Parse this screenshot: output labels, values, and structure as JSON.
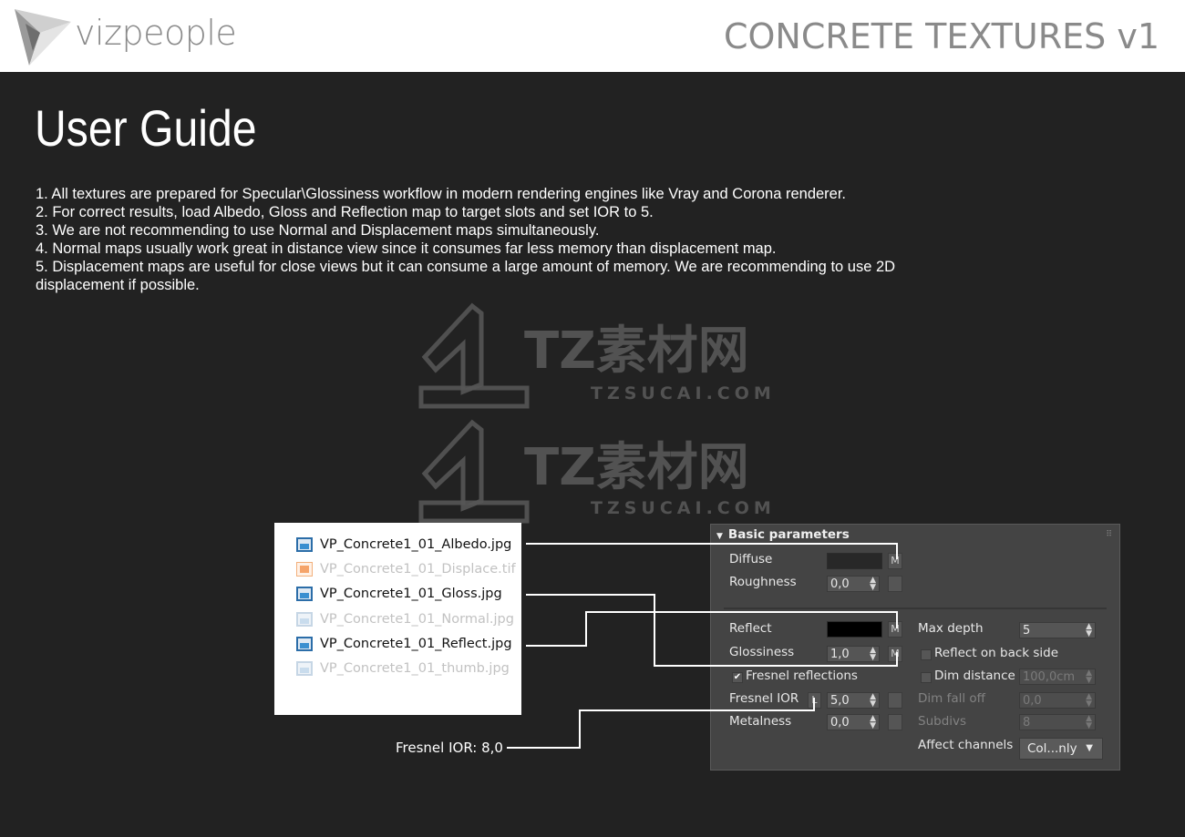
{
  "header": {
    "brand": "vizpeople",
    "product": "CONCRETE TEXTURES v1"
  },
  "title": "User Guide",
  "guide": [
    "1. All textures are prepared for Specular\\Glossiness workflow in modern rendering engines like Vray and Corona renderer.",
    "2. For correct results, load Albedo, Gloss and Reflection map to target slots and set IOR to 5.",
    "3. We are not recommending to use Normal and Displacement maps simultaneously.",
    "4. Normal maps usually work great in distance view since it consumes far less memory than displacement map.",
    "5. Displacement maps are useful for close views but it can consume a large amount of memory. We are recommending to use 2D displacement if possible."
  ],
  "watermark": {
    "text": "TZ素材网",
    "url": "TZSUCAI.COM"
  },
  "files": [
    {
      "name": "VP_Concrete1_01_Albedo.jpg",
      "icon": "jpg-image-icon",
      "state": "highlighted"
    },
    {
      "name": "VP_Concrete1_01_Displace.tif",
      "icon": "tif-image-icon",
      "state": "dimmed"
    },
    {
      "name": "VP_Concrete1_01_Gloss.jpg",
      "icon": "jpg-image-icon",
      "state": "highlighted"
    },
    {
      "name": "VP_Concrete1_01_Normal.jpg",
      "icon": "jpg-image-icon",
      "state": "dimmed"
    },
    {
      "name": "VP_Concrete1_01_Reflect.jpg",
      "icon": "jpg-image-icon",
      "state": "highlighted"
    },
    {
      "name": "VP_Concrete1_01_thumb.jpg",
      "icon": "jpg-image-icon",
      "state": "dimmed"
    }
  ],
  "panel": {
    "title": "Basic parameters",
    "diffuse": "Diffuse",
    "roughness": "Roughness",
    "roughness_val": "0,0",
    "reflect": "Reflect",
    "glossiness": "Glossiness",
    "glossiness_val": "1,0",
    "fresnel": "Fresnel reflections",
    "fresnel_ior": "Fresnel IOR",
    "fresnel_ior_val": "5,0",
    "metalness": "Metalness",
    "metalness_val": "0,0",
    "max_depth": "Max depth",
    "max_depth_val": "5",
    "reflect_back": "Reflect on back side",
    "dim_distance": "Dim distance",
    "dim_distance_val": "100,0cm",
    "dim_falloff": "Dim fall off",
    "dim_falloff_val": "0,0",
    "subdivs": "Subdivs",
    "subdivs_val": "8",
    "affect": "Affect channels",
    "affect_val": "Col...nly",
    "m": "M",
    "l": "L",
    "check": "✔",
    "arrows": "▲▼",
    "triangle": "▼",
    "grip": "⠿",
    "diffuse_color": "#282828",
    "reflect_color": "#000000"
  },
  "note": "Fresnel IOR: 8,0"
}
